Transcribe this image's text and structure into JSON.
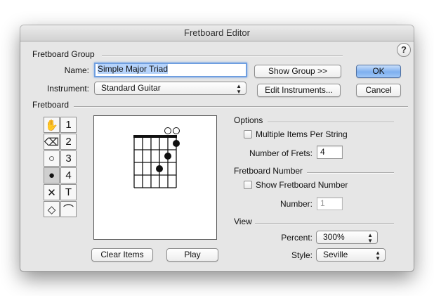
{
  "window": {
    "title": "Fretboard Editor"
  },
  "help": {
    "label": "?"
  },
  "fretboard_group": {
    "section_label": "Fretboard Group",
    "name_label": "Name:",
    "name_value": "Simple Major Triad",
    "instrument_label": "Instrument:",
    "instrument_value": "Standard Guitar",
    "show_group_label": "Show Group >>",
    "edit_instruments_label": "Edit Instruments...",
    "ok_label": "OK",
    "cancel_label": "Cancel"
  },
  "fretboard": {
    "section_label": "Fretboard",
    "tools": [
      {
        "name": "hand-tool-icon",
        "glyph": "✋"
      },
      {
        "name": "finger-1-tool",
        "glyph": "1"
      },
      {
        "name": "eraser-tool-icon",
        "glyph": "⌫"
      },
      {
        "name": "finger-2-tool",
        "glyph": "2"
      },
      {
        "name": "open-circle-tool-icon",
        "glyph": "○"
      },
      {
        "name": "finger-3-tool",
        "glyph": "3"
      },
      {
        "name": "filled-circle-tool-icon",
        "glyph": "●"
      },
      {
        "name": "finger-4-tool",
        "glyph": "4"
      },
      {
        "name": "x-mute-tool-icon",
        "glyph": "✕"
      },
      {
        "name": "thumb-t-tool",
        "glyph": "T"
      },
      {
        "name": "diamond-tool-icon",
        "glyph": "◇"
      },
      {
        "name": "barre-arc-tool-icon",
        "glyph": "⌒"
      }
    ],
    "clear_items_label": "Clear Items",
    "play_label": "Play",
    "diagram": {
      "strings": 6,
      "frets": 4,
      "open_strings": [
        5,
        6
      ],
      "dots": [
        {
          "string": 4,
          "fret": 3
        },
        {
          "string": 5,
          "fret": 2
        },
        {
          "string": 6,
          "fret": 1
        }
      ]
    }
  },
  "options": {
    "section_label": "Options",
    "multiple_items_label": "Multiple Items Per String",
    "multiple_items_checked": false,
    "num_frets_label": "Number of Frets:",
    "num_frets_value": "4"
  },
  "fretboard_number": {
    "section_label": "Fretboard Number",
    "show_label": "Show Fretboard Number",
    "show_checked": false,
    "number_label": "Number:",
    "number_value": "1"
  },
  "view": {
    "section_label": "View",
    "percent_label": "Percent:",
    "percent_value": "300%",
    "style_label": "Style:",
    "style_value": "Seville"
  }
}
